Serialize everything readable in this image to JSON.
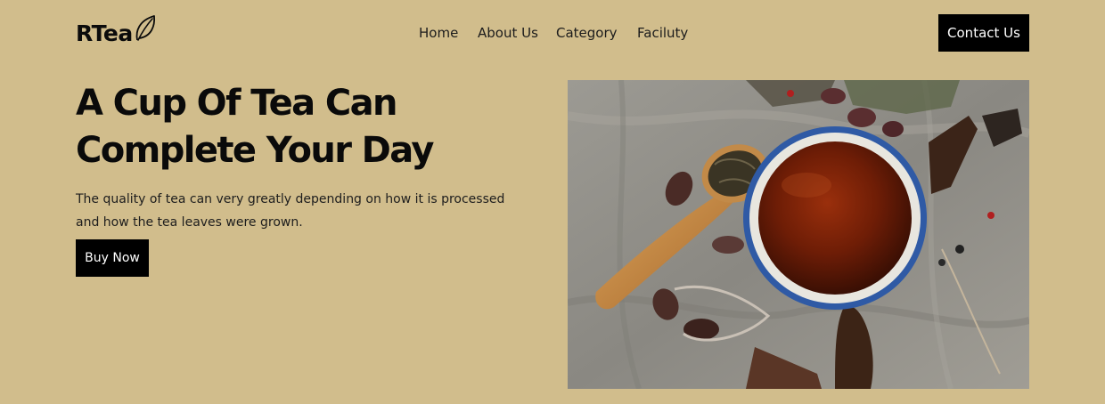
{
  "header": {
    "logo_text": "RTea",
    "logo_icon": "leaf-icon",
    "nav": [
      {
        "label": "Home"
      },
      {
        "label": "About Us"
      },
      {
        "label": "Category"
      },
      {
        "label": "Faciluty"
      }
    ],
    "contact_label": "Contact Us"
  },
  "hero": {
    "title_lines": [
      "A Cup Of Tea Can",
      "Complete Your Day"
    ],
    "description_lines": [
      "The quality of tea can very greatly depending on how it is processed",
      "and how the tea leaves were grown."
    ],
    "cta_label": "Buy Now",
    "image_subject": "cup-of-tea-photo"
  },
  "colors": {
    "page_background": "#d1bd8c",
    "button_background": "#000000",
    "button_text": "#ffffff",
    "text": "#0b0b0b"
  }
}
